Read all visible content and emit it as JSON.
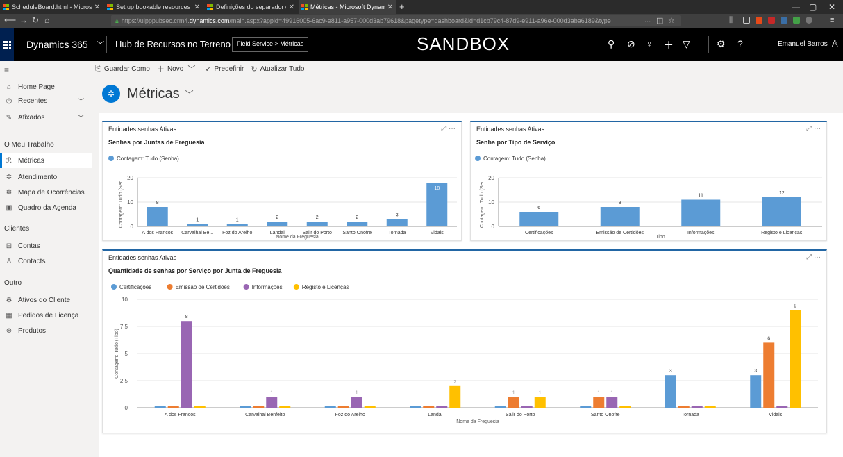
{
  "browser": {
    "tabs": [
      {
        "label": "ScheduleBoard.html - Microso",
        "active": false
      },
      {
        "label": "Set up bookable resources (Dy",
        "active": false
      },
      {
        "label": "Definições do separador do qu",
        "active": false
      },
      {
        "label": "Métricas - Microsoft Dynamic",
        "active": true
      }
    ],
    "url_prefix": "https://uipppubsec.crm4.",
    "url_domain": "dynamics.com",
    "url_rest": "/main.aspx?appid=49916005-6ac9-e811-a957-000d3ab79618&pagetype=dashboard&id=d1cb79c4-87d9-e911-a96e-000d3aba6189&type",
    "url_ellipsis": "..."
  },
  "topnav": {
    "brand": "Dynamics 365",
    "app": "Hub de Recursos no Terreno",
    "breadcrumb": "Field Service  >  Métricas",
    "environment": "SANDBOX",
    "user": "Emanuel Barros"
  },
  "commands": {
    "save_as": "Guardar Como",
    "new": "Novo",
    "default": "Predefinir",
    "refresh": "Atualizar Tudo"
  },
  "sidebar": {
    "home": "Home Page",
    "recent": "Recentes",
    "pinned": "Afixados",
    "group_work": "O Meu Trabalho",
    "metrics": "Métricas",
    "attendance": "Atendimento",
    "map": "Mapa de Ocorrências",
    "schedule": "Quadro da Agenda",
    "group_clients": "Clientes",
    "accounts": "Contas",
    "contacts": "Contacts",
    "group_other": "Outro",
    "assets": "Ativos do Cliente",
    "license": "Pedidos de Licença",
    "products": "Produtos"
  },
  "page": {
    "title": "Métricas"
  },
  "colors": {
    "blue": "#5b9bd5",
    "orange": "#ed7d31",
    "purple": "#9966b3",
    "yellow": "#ffc000",
    "accent": "#0078d4"
  },
  "chart_data": [
    {
      "type": "bar",
      "header": "Entidades senhas Ativas",
      "title": "Senhas por Juntas de Freguesia",
      "legend": "Contagem: Tudo (Senha)",
      "xlabel": "Nome da Freguesia",
      "ylabel": "Contagem: Tudo (Sen...",
      "ylim": [
        0,
        20
      ],
      "yticks": [
        0,
        10,
        20
      ],
      "categories": [
        "A dos Francos",
        "Carvalhal Be...",
        "Foz do Arelho",
        "Landal",
        "Salir do Porto",
        "Santo Onofre",
        "Tornada",
        "Vidais"
      ],
      "values": [
        8,
        1,
        1,
        2,
        2,
        2,
        3,
        18
      ]
    },
    {
      "type": "bar",
      "header": "Entidades senhas Ativas",
      "title": "Senha por Tipo de Serviço",
      "legend": "Contagem: Tudo (Senha)",
      "xlabel": "Tipo",
      "ylabel": "Contagem: Tudo (Sen...",
      "ylim": [
        0,
        20
      ],
      "yticks": [
        0,
        10,
        20
      ],
      "categories": [
        "Certificações",
        "Emissão de Certidões",
        "Informações",
        "Registo e Licenças"
      ],
      "values": [
        6,
        8,
        11,
        12
      ]
    },
    {
      "type": "bar",
      "header": "Entidades senhas Ativas",
      "title": "Quantidade de senhas por Serviço por Junta de Freguesia",
      "xlabel": "Nome da Freguesia",
      "ylabel": "Contagem: Tudo (Tipo)",
      "ylim": [
        0,
        10
      ],
      "yticks": [
        0,
        2.5,
        5,
        7.5,
        10
      ],
      "categories": [
        "A dos Francos",
        "Carvalhal Benfeito",
        "Foz do Arelho",
        "Landal",
        "Salir do Porto",
        "Santo Onofre",
        "Tornada",
        "Vidais"
      ],
      "series": [
        {
          "name": "Certificações",
          "values": [
            0,
            0,
            0,
            0,
            0,
            0,
            3,
            3
          ]
        },
        {
          "name": "Emissão de Certidões",
          "values": [
            0,
            0,
            0,
            0,
            1,
            1,
            0,
            6
          ]
        },
        {
          "name": "Informações",
          "values": [
            8,
            1,
            1,
            0,
            0,
            1,
            0,
            0
          ]
        },
        {
          "name": "Registo e Licenças",
          "values": [
            0,
            0,
            0,
            2,
            1,
            0,
            0,
            9
          ]
        }
      ]
    }
  ]
}
